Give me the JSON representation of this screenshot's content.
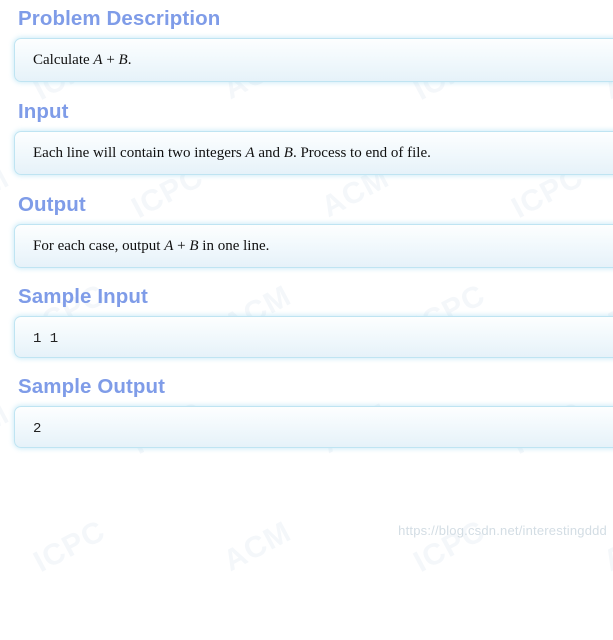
{
  "page": {
    "title": "Problem Description",
    "background_color": "#ffffff",
    "heading_color": "#7f9ce8",
    "panel_border_color": "#bfe4f2",
    "panel_glow_color": "#96d7f0"
  },
  "sections": [
    {
      "id": "problem-description",
      "heading": "Problem Description",
      "body_prefix": "Calculate ",
      "var_a": "A",
      "operator": " + ",
      "var_b": "B",
      "body_suffix": ".",
      "content_style": "serif"
    },
    {
      "id": "input",
      "heading": "Input",
      "body_prefix": "Each line will contain two integers ",
      "var_a": "A",
      "operator": " and ",
      "var_b": "B",
      "body_suffix": ". Process to end of file.",
      "content_style": "serif"
    },
    {
      "id": "output",
      "heading": "Output",
      "body_prefix": "For each case, output ",
      "var_a": "A",
      "operator": " + ",
      "var_b": "B",
      "body_suffix": " in one line.",
      "content_style": "serif"
    },
    {
      "id": "sample-input",
      "heading": "Sample Input",
      "code": "1 1",
      "content_style": "mono"
    },
    {
      "id": "sample-output",
      "heading": "Sample Output",
      "code": "2",
      "content_style": "mono"
    }
  ],
  "watermarks": {
    "csdn_url": "https://blog.csdn.net/interestingddd",
    "background_tiles": [
      "ACM",
      "ICPC",
      "ACM",
      "ICPC",
      "ACM",
      "ICPC",
      "ACM",
      "ICPC",
      "ACM",
      "ICPC",
      "ACM",
      "ICPC",
      "ACM",
      "ICPC",
      "ACM",
      "ICPC",
      "ACM",
      "ICPC",
      "ACM",
      "ICPC",
      "ACM",
      "ICPC",
      "ACM",
      "ICPC"
    ]
  }
}
